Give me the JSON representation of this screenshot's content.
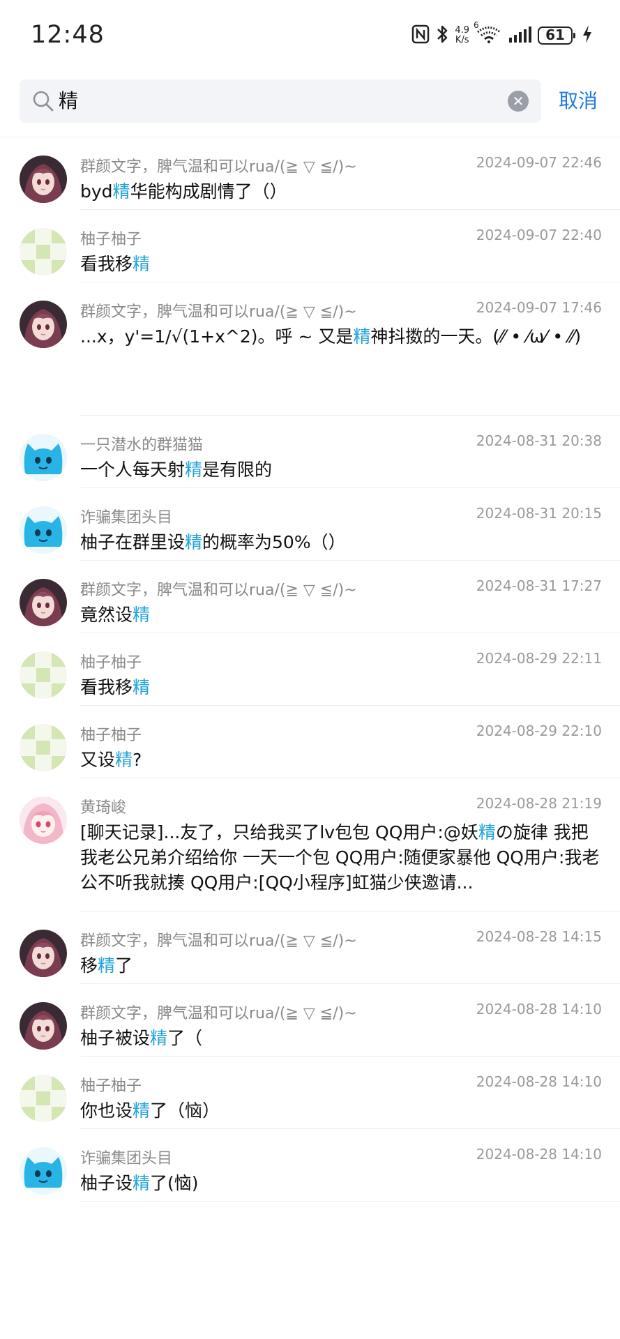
{
  "status_bar": {
    "time": "12:48",
    "net_speed_value": "4.9",
    "net_speed_unit": "K/s",
    "wifi_label": "6",
    "battery": "61"
  },
  "search": {
    "query": "精",
    "cancel_label": "取消"
  },
  "colors": {
    "highlight": "#22a3d8",
    "accent": "#1f7ae0",
    "secondary_text": "#8a8a8a"
  },
  "results": [
    {
      "sender": "群颜文字，脾气温和可以rua/(≧ ▽ ≦/)~",
      "time": "2024-09-07 22:46",
      "avatar_icon": "anime-girl-avatar",
      "message": {
        "before": "byd",
        "match": "精",
        "after": "华能构成剧情了（）"
      }
    },
    {
      "sender": "柚子柚子",
      "time": "2024-09-07 22:40",
      "avatar_icon": "green-checker-avatar",
      "message": {
        "before": "看我移",
        "match": "精",
        "after": ""
      }
    },
    {
      "sender": "群颜文字，脾气温和可以rua/(≧ ▽ ≦/)~",
      "time": "2024-09-07 17:46",
      "avatar_icon": "anime-girl-avatar",
      "message": {
        "before": "...x，y'=1/√(1+x^2)。呼 ~ 又是",
        "match": "精",
        "after": "神抖擞的一天。(⁄⁄ • ⁄ω⁄ • ⁄⁄)"
      }
    },
    {
      "sender": "一只潜水的群猫猫",
      "time": "2024-08-31 20:38",
      "avatar_icon": "blue-cat-avatar",
      "message": {
        "before": "一个人每天射",
        "match": "精",
        "after": "是有限的"
      }
    },
    {
      "sender": "诈骗集团头目",
      "time": "2024-08-31 20:15",
      "avatar_icon": "blue-cat-avatar",
      "message": {
        "before": "柚子在群里设",
        "match": "精",
        "after": "的概率为50%（）"
      }
    },
    {
      "sender": "群颜文字，脾气温和可以rua/(≧ ▽ ≦/)~",
      "time": "2024-08-31 17:27",
      "avatar_icon": "anime-girl-avatar",
      "message": {
        "before": "竟然设",
        "match": "精",
        "after": ""
      }
    },
    {
      "sender": "柚子柚子",
      "time": "2024-08-29 22:11",
      "avatar_icon": "green-checker-avatar",
      "message": {
        "before": "看我移",
        "match": "精",
        "after": ""
      }
    },
    {
      "sender": "柚子柚子",
      "time": "2024-08-29 22:10",
      "avatar_icon": "green-checker-avatar",
      "message": {
        "before": "又设",
        "match": "精",
        "after": "?"
      }
    },
    {
      "sender": "黄琦峻",
      "time": "2024-08-28 21:19",
      "avatar_icon": "pink-hair-girl-avatar",
      "message": {
        "before": "[聊天记录]...友了，只给我买了lv包包 QQ用户:@妖",
        "match": "精",
        "after": "の旋律 我把我老公兄弟介绍给你 一天一个包 QQ用户:随便家暴他 QQ用户:我老公不听我就揍 QQ用户:[QQ小程序]虹猫少侠邀请..."
      }
    },
    {
      "sender": "群颜文字，脾气温和可以rua/(≧ ▽ ≦/)~",
      "time": "2024-08-28 14:15",
      "avatar_icon": "anime-girl-avatar",
      "message": {
        "before": "移",
        "match": "精",
        "after": "了"
      }
    },
    {
      "sender": "群颜文字，脾气温和可以rua/(≧ ▽ ≦/)~",
      "time": "2024-08-28 14:10",
      "avatar_icon": "anime-girl-avatar",
      "message": {
        "before": "柚子被设",
        "match": "精",
        "after": "了（"
      }
    },
    {
      "sender": "柚子柚子",
      "time": "2024-08-28 14:10",
      "avatar_icon": "green-checker-avatar",
      "message": {
        "before": "你也设",
        "match": "精",
        "after": "了（恼）"
      }
    },
    {
      "sender": "诈骗集团头目",
      "time": "2024-08-28 14:10",
      "avatar_icon": "blue-cat-avatar",
      "message": {
        "before": "柚子设",
        "match": "精",
        "after": "了(恼)"
      }
    }
  ]
}
